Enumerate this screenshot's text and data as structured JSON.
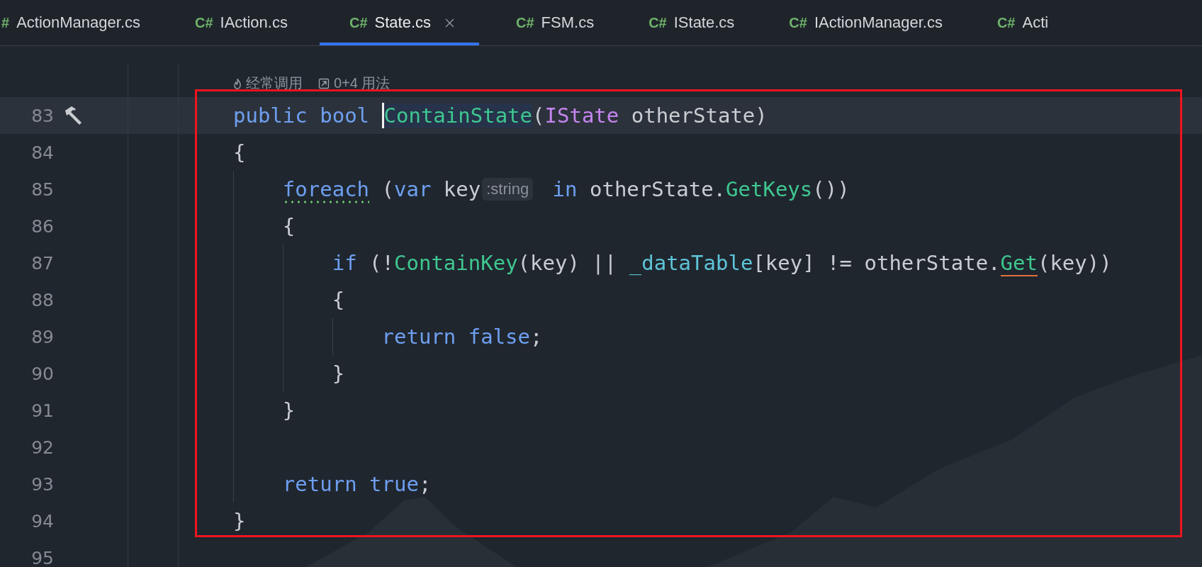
{
  "tabs": [
    {
      "icon": "#",
      "label": "ActionManager.cs",
      "selected": false
    },
    {
      "icon": "C#",
      "label": "IAction.cs",
      "selected": false
    },
    {
      "icon": "C#",
      "label": "State.cs",
      "selected": true,
      "closable": true
    },
    {
      "icon": "C#",
      "label": "FSM.cs",
      "selected": false
    },
    {
      "icon": "C#",
      "label": "IState.cs",
      "selected": false
    },
    {
      "icon": "C#",
      "label": "IActionManager.cs",
      "selected": false
    },
    {
      "icon": "C#",
      "label": "Acti",
      "selected": false
    }
  ],
  "code_lens": [
    {
      "kind": "flame",
      "text": "经常调用"
    },
    {
      "kind": "usages",
      "text": "0+4 用法"
    }
  ],
  "lines": [
    {
      "number": "83",
      "current": true,
      "gutter_icon": {
        "kind": "hammer"
      },
      "tokens": [
        {
          "kind": "keyword",
          "text": "public bool "
        },
        {
          "kind": "method",
          "text": "ContainState",
          "highlighted": true,
          "caret_before": true
        },
        {
          "kind": "plain",
          "text": "("
        },
        {
          "kind": "type",
          "text": "IState"
        },
        {
          "kind": "plain",
          "text": " otherState)"
        }
      ]
    },
    {
      "number": "84",
      "current": false,
      "tokens": [
        {
          "kind": "plain",
          "text": "{"
        }
      ]
    },
    {
      "number": "85",
      "current": false,
      "tokens": [
        {
          "kind": "keyword",
          "text": "    foreach",
          "underline": {
            "kind": "dotted"
          }
        },
        {
          "kind": "plain",
          "text": " ("
        },
        {
          "kind": "keyword",
          "text": "var"
        },
        {
          "kind": "plain",
          "text": " key"
        },
        {
          "kind": "hint",
          "text": ":string"
        },
        {
          "kind": "keyword",
          "text": " in"
        },
        {
          "kind": "plain",
          "text": " otherState."
        },
        {
          "kind": "method",
          "text": "GetKeys"
        },
        {
          "kind": "plain",
          "text": "())"
        }
      ]
    },
    {
      "number": "86",
      "current": false,
      "tokens": [
        {
          "kind": "plain",
          "text": "    {"
        }
      ]
    },
    {
      "number": "87",
      "current": false,
      "tokens": [
        {
          "kind": "keyword",
          "text": "        if"
        },
        {
          "kind": "plain",
          "text": " (!"
        },
        {
          "kind": "method",
          "text": "ContainKey"
        },
        {
          "kind": "plain",
          "text": "(key) || "
        },
        {
          "kind": "field",
          "text": "_dataTable"
        },
        {
          "kind": "plain",
          "text": "[key] != otherState."
        },
        {
          "kind": "method",
          "text": "Get",
          "underline": {
            "kind": "warning"
          }
        },
        {
          "kind": "plain",
          "text": "(key))"
        }
      ]
    },
    {
      "number": "88",
      "current": false,
      "tokens": [
        {
          "kind": "plain",
          "text": "        {"
        }
      ]
    },
    {
      "number": "89",
      "current": false,
      "tokens": [
        {
          "kind": "keyword",
          "text": "            return false"
        },
        {
          "kind": "plain",
          "text": ";"
        }
      ]
    },
    {
      "number": "90",
      "current": false,
      "tokens": [
        {
          "kind": "plain",
          "text": "        }"
        }
      ]
    },
    {
      "number": "91",
      "current": false,
      "tokens": [
        {
          "kind": "plain",
          "text": "    }"
        }
      ]
    },
    {
      "number": "92",
      "current": false
    },
    {
      "number": "93",
      "current": false,
      "tokens": [
        {
          "kind": "keyword",
          "text": "    return true"
        },
        {
          "kind": "plain",
          "text": ";"
        }
      ]
    },
    {
      "number": "94",
      "current": false,
      "tokens": [
        {
          "kind": "plain",
          "text": "}"
        }
      ]
    },
    {
      "number": "95",
      "current": false
    }
  ],
  "annotation": {
    "kind": "frame"
  }
}
